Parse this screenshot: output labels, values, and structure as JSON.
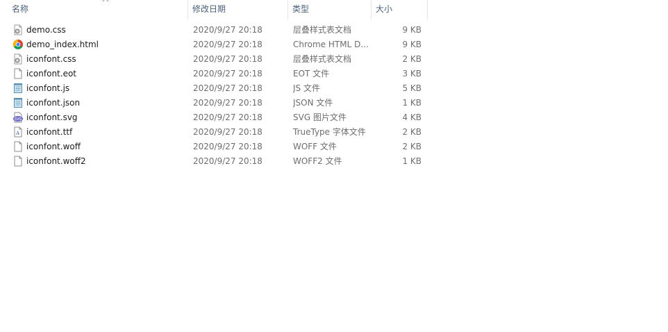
{
  "columns": {
    "name": "名称",
    "date": "修改日期",
    "type": "类型",
    "size": "大小"
  },
  "files": [
    {
      "name": "demo.css",
      "date": "2020/9/27 20:18",
      "type": "层叠样式表文档",
      "size": "9 KB",
      "icon": "css-settings-icon"
    },
    {
      "name": "demo_index.html",
      "date": "2020/9/27 20:18",
      "type": "Chrome HTML D...",
      "size": "9 KB",
      "icon": "chrome-icon"
    },
    {
      "name": "iconfont.css",
      "date": "2020/9/27 20:18",
      "type": "层叠样式表文档",
      "size": "2 KB",
      "icon": "css-settings-icon"
    },
    {
      "name": "iconfont.eot",
      "date": "2020/9/27 20:18",
      "type": "EOT 文件",
      "size": "3 KB",
      "icon": "blank-file-icon"
    },
    {
      "name": "iconfont.js",
      "date": "2020/9/27 20:18",
      "type": "JS 文件",
      "size": "5 KB",
      "icon": "notepad-icon"
    },
    {
      "name": "iconfont.json",
      "date": "2020/9/27 20:18",
      "type": "JSON 文件",
      "size": "1 KB",
      "icon": "notepad-icon"
    },
    {
      "name": "iconfont.svg",
      "date": "2020/9/27 20:18",
      "type": "SVG 图片文件",
      "size": "4 KB",
      "icon": "svg-icon"
    },
    {
      "name": "iconfont.ttf",
      "date": "2020/9/27 20:18",
      "type": "TrueType 字体文件",
      "size": "2 KB",
      "icon": "font-file-icon"
    },
    {
      "name": "iconfont.woff",
      "date": "2020/9/27 20:18",
      "type": "WOFF 文件",
      "size": "2 KB",
      "icon": "blank-file-icon"
    },
    {
      "name": "iconfont.woff2",
      "date": "2020/9/27 20:18",
      "type": "WOFF2 文件",
      "size": "1 KB",
      "icon": "blank-file-icon"
    }
  ]
}
